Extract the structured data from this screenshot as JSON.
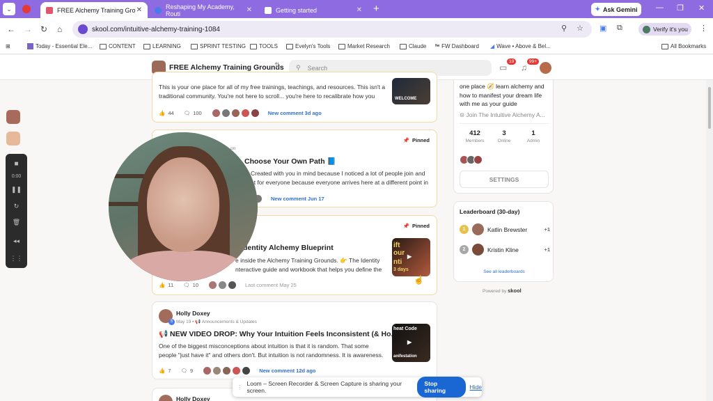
{
  "colors": {
    "tabbar": "#8e6be0",
    "accent_blue": "#2f6fd6",
    "pin_border": "#f3d9a4",
    "stop_btn": "#1a66d2"
  },
  "browser": {
    "tabs": [
      {
        "label": "FREE Alchemy Training Gro",
        "active": true
      },
      {
        "label": "Reshaping My Academy, Routi",
        "active": false
      },
      {
        "label": "Getting started",
        "active": false
      }
    ],
    "ask_gemini": "Ask Gemini",
    "url": "skool.com/intuitive-alchemy-training-1084",
    "verify_label": "Verify it's you",
    "bookmarks": [
      "Today - Essential Ele...",
      "CONTENT",
      "LEARNING",
      "SPRINT TESTING",
      "TOOLS",
      "Evelyn's Tools",
      "Market Research",
      "Claude",
      "FW Dashboard",
      "Wave • Above & Bel..."
    ],
    "all_bookmarks": "All Bookmarks"
  },
  "header": {
    "group_title": "FREE Alchemy Training Grounds",
    "search_placeholder": "Search",
    "chat_badge": "19",
    "notif_badge": "99+"
  },
  "posts": [
    {
      "excerpt_1": "This is your one place for all of my free trainings, teachings, and resources. This isn't a",
      "excerpt_2": "traditional community. You're not here to scroll... you're here to recalibrate how you",
      "likes": "44",
      "comments": "100",
      "activity": "New comment 3d ago",
      "thumb_text": "WELCOME"
    },
    {
      "pinned_label": "Pinned",
      "meta_fragment": "on",
      "title": "Choose Your Own Path 📘",
      "excerpt_1": "Created with you in mind because I noticed a lot of people join and",
      "excerpt_2": "nt for everyone because everyone arrives here at a different point in",
      "activity": "New comment Jun 17"
    },
    {
      "pinned_label": "Pinned",
      "title": "dentity Alchemy Blueprint",
      "excerpt_1": "e inside the Alchemy Training Grounds. 👉 The Identity",
      "excerpt_2": "nteractive guide and workbook that helps you define the",
      "likes": "11",
      "comments": "10",
      "activity": "Last comment May 25",
      "thumb_text_1": "ift",
      "thumb_text_2": "our",
      "thumb_text_3": "nti",
      "thumb_text_4": "3 days"
    },
    {
      "author": "Holly Doxey",
      "author_level": "5",
      "meta": "May 19 • 📢 Announcements & Updates",
      "title": "📢 NEW VIDEO DROP: Why Your Intuition Feels Inconsistent (& Ho...",
      "excerpt_1": "One of the biggest misconceptions about intuition is that it is random. That some",
      "excerpt_2": "people \"just have it\" and others don't. But intuition is not randomness. It is awareness.",
      "likes": "7",
      "comments": "9",
      "activity": "New comment 12d ago",
      "thumb_text_1": "heat Code",
      "thumb_text_2": "anifestation"
    },
    {
      "author": "Holly Doxey"
    }
  ],
  "sidebar": {
    "description": "one place 🧭 learn alchemy and how to manifest your dream life with me as your guide",
    "join_link": "Join The Intuitive Alchemy A...",
    "stats": [
      {
        "num": "412",
        "label": "Members"
      },
      {
        "num": "3",
        "label": "Online"
      },
      {
        "num": "1",
        "label": "Admin"
      }
    ],
    "settings": "SETTINGS",
    "leaderboard_title": "Leaderboard (30-day)",
    "leaders": [
      {
        "rank": "1",
        "name": "Katlin Brewster",
        "points": "+1"
      },
      {
        "rank": "2",
        "name": "Kristin Kline",
        "points": "+1"
      }
    ],
    "leaderboard_link": "See all leaderboards",
    "powered_by": "Powered by",
    "powered_brand": "skool"
  },
  "loom": {
    "timer": "0:00",
    "share_message": "Loom – Screen Recorder & Screen Capture is sharing your screen.",
    "stop_sharing": "Stop sharing",
    "hide": "Hide"
  }
}
